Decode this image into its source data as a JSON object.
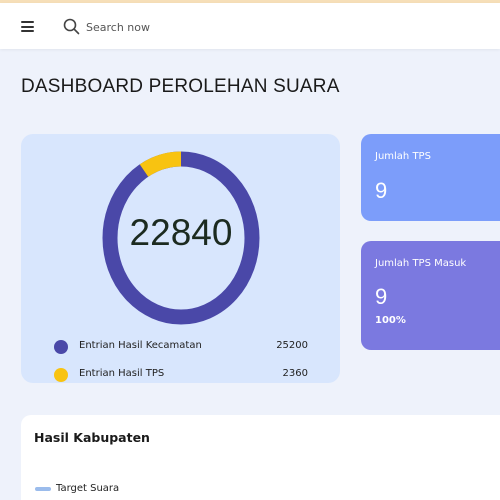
{
  "header": {
    "search_placeholder": "Search now",
    "menu_icon": "menu-icon",
    "search_icon": "search-icon"
  },
  "page": {
    "title": "DASHBOARD PEROLEHAN SUARA"
  },
  "donut_card": {
    "center_value": "22840",
    "legend": [
      {
        "label": "Entrian Hasil Kecamatan",
        "value": "25200",
        "color": "#4a48a8"
      },
      {
        "label": "Entrian Hasil TPS",
        "value": "2360",
        "color": "#f8c311"
      }
    ]
  },
  "stats": {
    "jumlah_tps": {
      "label": "Jumlah TPS",
      "value": "9",
      "color": "#7c9dfa"
    },
    "jumlah_tps_masuk": {
      "label": "Jumlah TPS Masuk",
      "value": "9",
      "sub": "100%",
      "color": "#7b79e0"
    }
  },
  "kabupaten": {
    "title": "Hasil Kabupaten",
    "legend_label": "Target Suara",
    "legend_color": "#9bbcec"
  }
}
